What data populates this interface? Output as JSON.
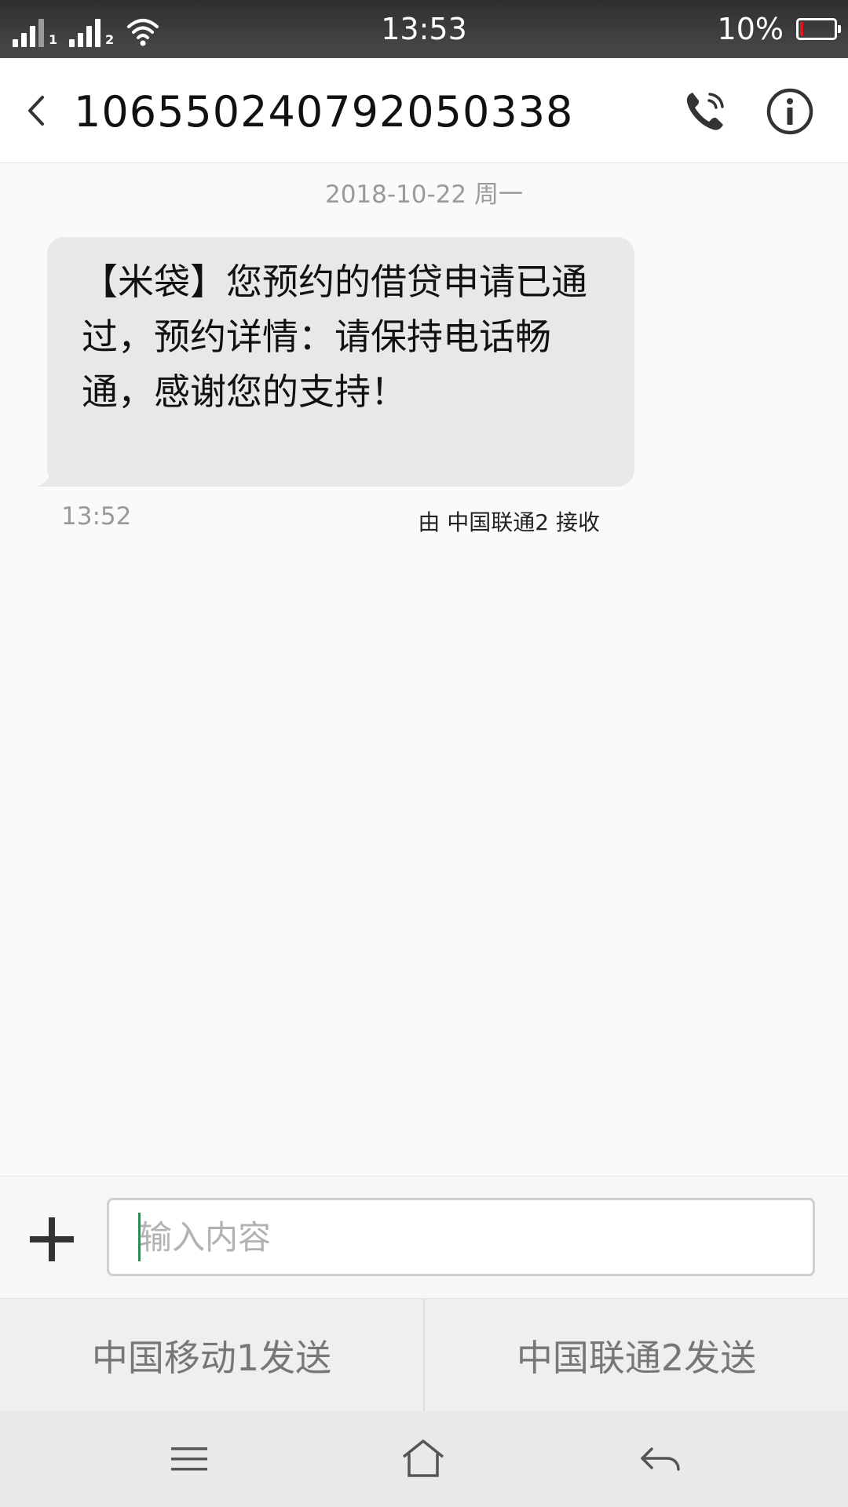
{
  "status_bar": {
    "sim1_label": "1",
    "sim2_label": "2",
    "time": "13:53",
    "battery_percent_text": "10%",
    "battery_level": 0.1,
    "battery_color": "#e0141e"
  },
  "header": {
    "title": "10655024079205033​8",
    "icons": {
      "back": "chevron-left-icon",
      "call": "phone-icon",
      "info": "info-icon"
    }
  },
  "conversation": {
    "date_separator": "2018-10-22 周一",
    "messages": [
      {
        "text": "【米袋】您预约的借贷申请已通过，预约详情：请保持电话畅通，感谢您的支持！",
        "sim_info": "由 中国联通2 接收",
        "time": "13:52"
      }
    ]
  },
  "composer": {
    "placeholder": "输入内容",
    "value": "",
    "add_icon": "plus-icon"
  },
  "send_buttons": {
    "sim1": "中国移动1发送",
    "sim2": "中国联通2发送"
  },
  "nav_bar": {
    "icons": {
      "menu": "menu-icon",
      "home": "home-icon",
      "back": "back-arrow-icon"
    }
  },
  "colors": {
    "status_bar": "#3a3a3a",
    "bubble": "#e8e8e8",
    "caret": "#2e8b57"
  }
}
